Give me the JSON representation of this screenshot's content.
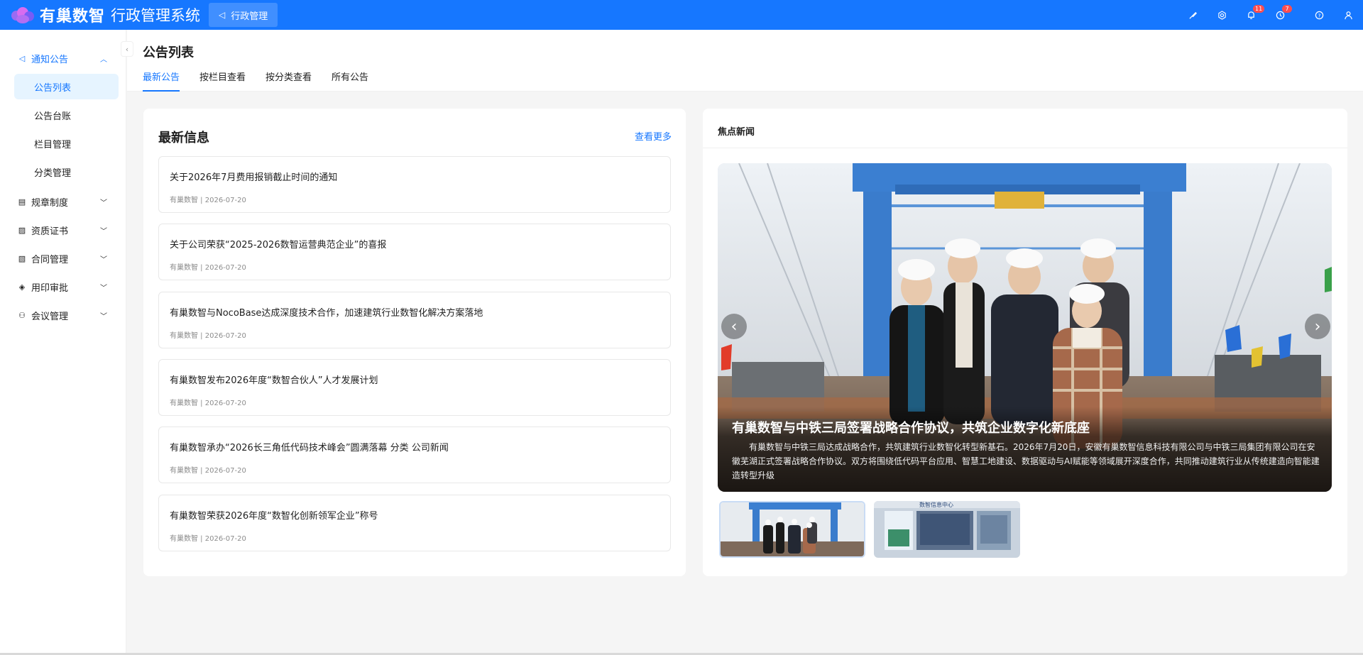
{
  "header": {
    "logo_text": "有巢数智",
    "app_title": "行政管理系统",
    "top_menu": {
      "label": "行政管理"
    },
    "actions": [
      {
        "icon": "brush-icon",
        "badge": ""
      },
      {
        "icon": "gear-icon",
        "badge": ""
      },
      {
        "icon": "bell-icon",
        "badge": "11"
      },
      {
        "icon": "clock-icon",
        "badge": "7"
      },
      {
        "icon": "help-icon",
        "badge": ""
      },
      {
        "icon": "user-icon",
        "badge": ""
      }
    ]
  },
  "sidebar": {
    "groups": [
      {
        "label": "通知公告",
        "icon": "sound-icon",
        "open": true,
        "items": [
          {
            "label": "公告列表",
            "active": true
          },
          {
            "label": "公告台账",
            "active": false
          },
          {
            "label": "栏目管理",
            "active": false
          },
          {
            "label": "分类管理",
            "active": false
          }
        ]
      },
      {
        "label": "规章制度",
        "icon": "file-icon",
        "open": false
      },
      {
        "label": "资质证书",
        "icon": "certificate-icon",
        "open": false
      },
      {
        "label": "合同管理",
        "icon": "contract-icon",
        "open": false
      },
      {
        "label": "用印审批",
        "icon": "seal-icon",
        "open": false
      },
      {
        "label": "会议管理",
        "icon": "meeting-icon",
        "open": false
      }
    ]
  },
  "page": {
    "title": "公告列表",
    "tabs": [
      {
        "label": "最新公告",
        "active": true
      },
      {
        "label": "按栏目查看",
        "active": false
      },
      {
        "label": "按分类查看",
        "active": false
      },
      {
        "label": "所有公告",
        "active": false
      }
    ]
  },
  "latest": {
    "title": "最新信息",
    "more": "查看更多",
    "items": [
      {
        "title": "关于2026年7月费用报销截止时间的通知",
        "meta": "有巢数智 | 2026-07-20"
      },
      {
        "title": "关于公司荣获“2025-2026数智运营典范企业”的喜报",
        "meta": "有巢数智 | 2026-07-20"
      },
      {
        "title": "有巢数智与NocoBase达成深度技术合作，加速建筑行业数智化解决方案落地",
        "meta": "有巢数智 | 2026-07-20"
      },
      {
        "title": "有巢数智发布2026年度“数智合伙人”人才发展计划",
        "meta": "有巢数智 | 2026-07-20"
      },
      {
        "title": "有巢数智承办“2026长三角低代码技术峰会”圆满落幕 分类 公司新闻",
        "meta": "有巢数智 | 2026-07-20"
      },
      {
        "title": "有巢数智荣获2026年度“数智化创新领军企业”称号",
        "meta": "有巢数智 | 2026-07-20"
      }
    ]
  },
  "focus": {
    "title": "焦点新闻",
    "slide": {
      "title": "有巢数智与中铁三局签署战略合作协议，共筑企业数字化新底座",
      "desc": "有巢数智与中铁三局达成战略合作，共筑建筑行业数智化转型新基石。2026年7月20日，安徽有巢数智信息科技有限公司与中铁三局集团有限公司在安徽芜湖正式签署战略合作协议。双方将围绕低代码平台应用、智慧工地建设、数据驱动与AI赋能等领域展开深度合作，共同推动建筑行业从传统建造向智能建造转型升级"
    },
    "thumb_banner_text": "数智信息中心",
    "colors": {
      "accent": "#1677ff",
      "header": "#1677ff",
      "badge": "#ff4d4f"
    }
  }
}
